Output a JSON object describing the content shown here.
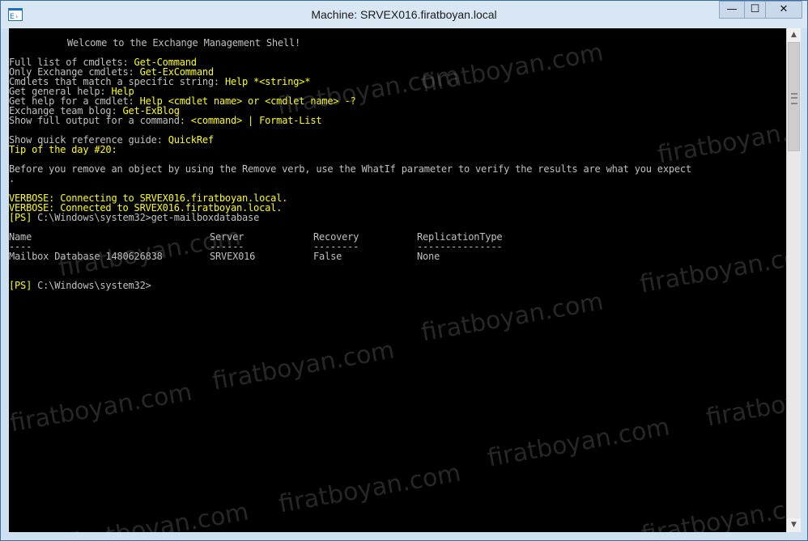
{
  "window": {
    "title": "Machine: SRVEX016.firatboyan.local",
    "controls": {
      "minimize": "—",
      "maximize": "☐",
      "close": "✕"
    }
  },
  "console": {
    "welcome": "Welcome to the Exchange Management Shell!",
    "help_lines": [
      {
        "label": "Full list of cmdlets: ",
        "value": "Get-Command"
      },
      {
        "label": "Only Exchange cmdlets: ",
        "value": "Get-ExCommand"
      },
      {
        "label": "Cmdlets that match a specific string: ",
        "value": "Help *<string>*"
      },
      {
        "label": "Get general help: ",
        "value": "Help"
      },
      {
        "label": "Get help for a cmdlet: ",
        "value": "Help <cmdlet name> or <cmdlet name> -?"
      },
      {
        "label": "Exchange team blog: ",
        "value": "Get-ExBlog"
      },
      {
        "label": "Show full output for a command: ",
        "value": "<command> | Format-List"
      }
    ],
    "quickref": {
      "label": "Show quick reference guide: ",
      "value": "QuickRef"
    },
    "tip_title": "Tip of the day #20:",
    "tip_text": "Before you remove an object by using the Remove verb, use the WhatIf parameter to verify the results are what you expect",
    "tip_text_wrap": ".",
    "verbose_1": "VERBOSE: Connecting to SRVEX016.firatboyan.local.",
    "verbose_2": "VERBOSE: Connected to SRVEX016.firatboyan.local.",
    "prompt_tag": "[PS]",
    "prompt_path": " C:\\Windows\\system32>",
    "command": "get-mailboxdatabase",
    "table": {
      "headers": [
        "Name",
        "Server",
        "Recovery",
        "ReplicationType"
      ],
      "underlines": [
        "----",
        "------",
        "--------",
        "---------------"
      ],
      "rows": [
        [
          "Mailbox Database 1480626838",
          "SRVEX016",
          "False",
          "None"
        ]
      ]
    },
    "prompt2_tag": "[PS]",
    "prompt2_path": " C:\\Windows\\system32>"
  },
  "watermark": "firatboyan.com"
}
